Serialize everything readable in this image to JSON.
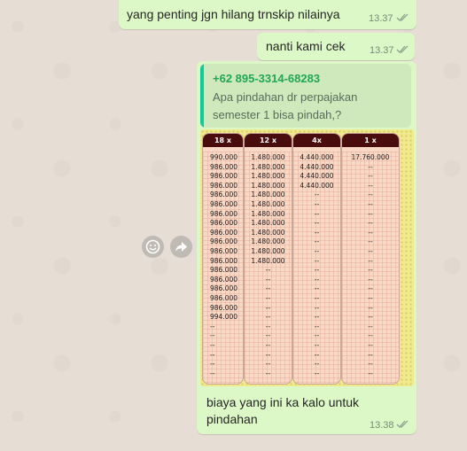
{
  "messages": {
    "m1": {
      "text": "yang penting jgn hilang trnskip nilainya",
      "time": "13.37"
    },
    "m2": {
      "text": "nanti kami cek",
      "time": "13.37"
    },
    "m3": {
      "quote_author": "+62 895-3314-68283",
      "quote_line1": "Apa pindahan dr perpajakan",
      "quote_line2": "semester 1 bisa pindah,?",
      "caption_line1": "biaya yang ini ka kalo untuk",
      "caption_line2": "pindahan",
      "time": "13.38"
    }
  },
  "image_table": {
    "columns": [
      {
        "header": "18 x",
        "cells": [
          "990.000",
          "986.000",
          "986.000",
          "986.000",
          "986.000",
          "986.000",
          "986.000",
          "986.000",
          "986.000",
          "986.000",
          "986.000",
          "986.000",
          "986.000",
          "986.000",
          "986.000",
          "986.000",
          "986.000",
          "994.000",
          "--",
          "--",
          "--",
          "--",
          "--",
          "--"
        ]
      },
      {
        "header": "12 x",
        "cells": [
          "1.480.000",
          "1.480.000",
          "1.480.000",
          "1.480.000",
          "1.480.000",
          "1.480.000",
          "1.480.000",
          "1.480.000",
          "1.480.000",
          "1.480.000",
          "1.480.000",
          "1.480.000",
          "--",
          "--",
          "--",
          "--",
          "--",
          "--",
          "--",
          "--",
          "--",
          "--",
          "--",
          "--"
        ]
      },
      {
        "header": "4x",
        "cells": [
          "4.440.000",
          "4.440.000",
          "4.440.000",
          "4.440.000",
          "--",
          "--",
          "--",
          "--",
          "--",
          "--",
          "--",
          "--",
          "--",
          "--",
          "--",
          "--",
          "--",
          "--",
          "--",
          "--",
          "--",
          "--",
          "--",
          "--"
        ]
      },
      {
        "header": "1 x",
        "cells": [
          "17.760.000",
          "--",
          "--",
          "--",
          "--",
          "--",
          "--",
          "--",
          "--",
          "--",
          "--",
          "--",
          "--",
          "--",
          "--",
          "--",
          "--",
          "--",
          "--",
          "--",
          "--",
          "--",
          "--",
          "--"
        ]
      }
    ]
  },
  "icons": {
    "read": "double-check-icon",
    "emoji": "smiley-icon",
    "forward": "forward-icon"
  }
}
